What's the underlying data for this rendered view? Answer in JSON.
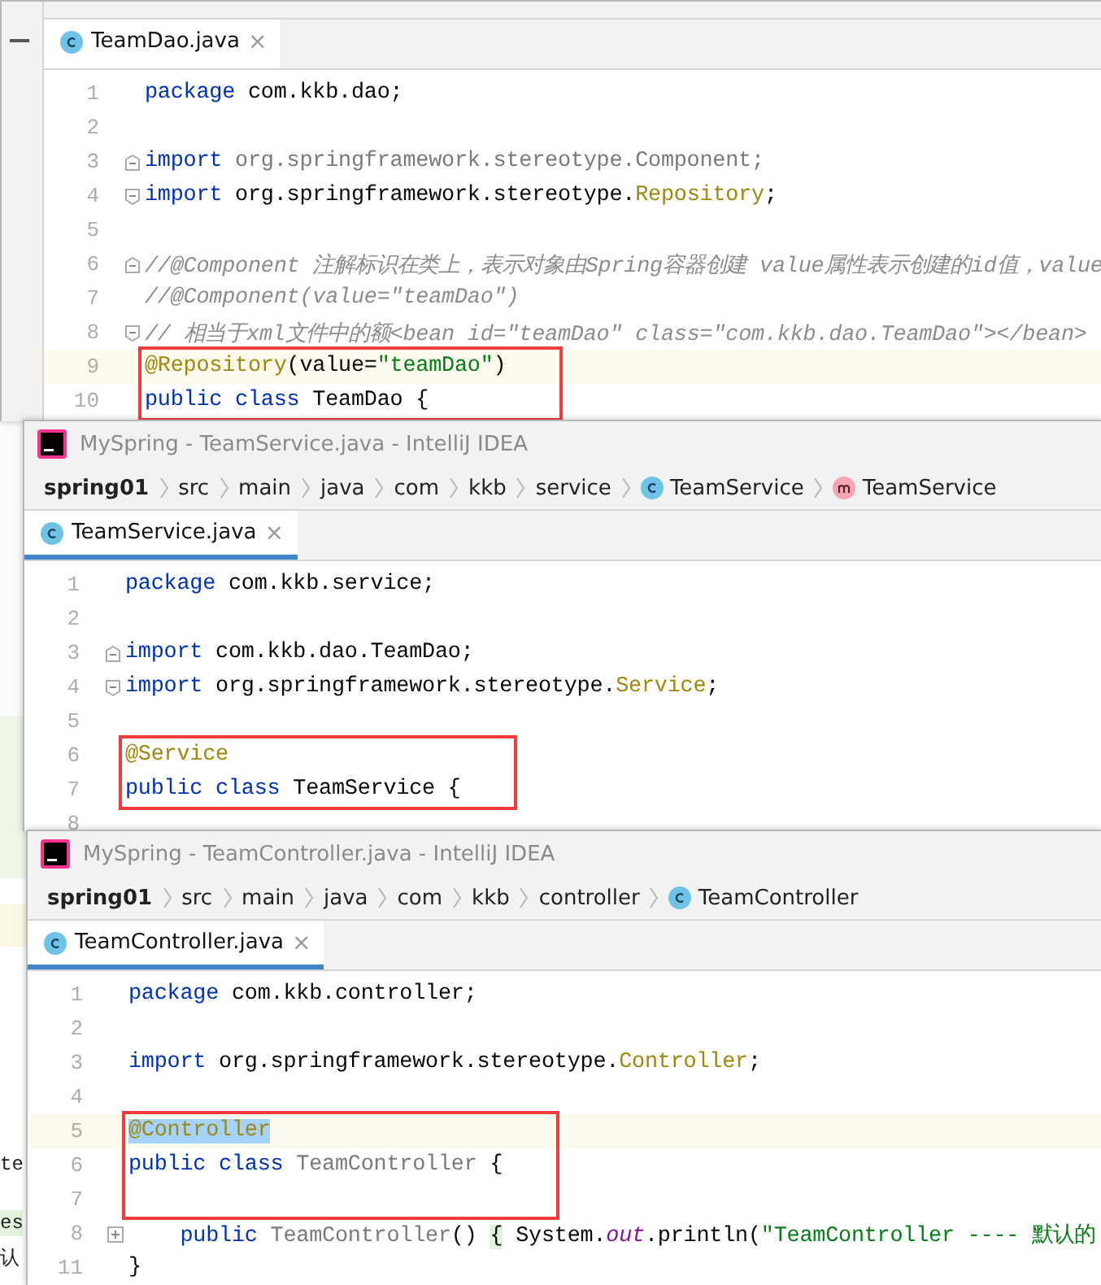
{
  "background_fragments": [
    {
      "text": "te",
      "kind": "plain"
    },
    {
      "text": "es",
      "kind": "string"
    },
    {
      "text": "认",
      "kind": "plain"
    }
  ],
  "windows": [
    {
      "kind": "editor-only",
      "tab": {
        "label": "TeamDao.java",
        "close": "×",
        "selected": false
      },
      "lines": [
        {
          "number": "1",
          "tokens": [
            {
              "kind": "kw",
              "text": "package"
            },
            {
              "kind": "plain",
              "text": " com.kkb.dao;"
            }
          ]
        },
        {
          "number": "2"
        },
        {
          "number": "3",
          "kind": "fold-start",
          "tokens": [
            {
              "kind": "kw",
              "text": "import"
            },
            {
              "kind": "unused",
              "text": " org.springframework.stereotype.Component;"
            }
          ]
        },
        {
          "number": "4",
          "kind": "fold-end",
          "tokens": [
            {
              "kind": "kw",
              "text": "import"
            },
            {
              "kind": "plain",
              "text": " org.springframework.stereotype."
            },
            {
              "kind": "ann",
              "text": "Repository"
            },
            {
              "kind": "plain",
              "text": ";"
            }
          ]
        },
        {
          "number": "5"
        },
        {
          "number": "6",
          "kind": "fold-start",
          "tokens": [
            {
              "kind": "comment",
              "text": "//@Component 注解标识在类上，表示对象由Spring容器创建 value属性表示创建的id值，value"
            }
          ]
        },
        {
          "number": "7",
          "tokens": [
            {
              "kind": "comment",
              "text": "//@Component(value=\"teamDao\")"
            }
          ]
        },
        {
          "number": "8",
          "kind": "fold-end",
          "tokens": [
            {
              "kind": "comment",
              "text": "// 相当于xml文件中的额<bean id=\"teamDao\" class=\"com.kkb.dao.TeamDao\"></bean>"
            }
          ]
        },
        {
          "number": "9",
          "current": true,
          "boxed": true,
          "tokens": [
            {
              "kind": "ann",
              "text": "@Repository"
            },
            {
              "kind": "plain",
              "text": "(value="
            },
            {
              "kind": "str",
              "text": "\"teamDao\""
            },
            {
              "kind": "plain",
              "text": ")"
            }
          ]
        },
        {
          "number": "10",
          "boxed": true,
          "tokens": [
            {
              "kind": "kw",
              "text": "public class"
            },
            {
              "kind": "plain",
              "text": " TeamDao {"
            }
          ]
        }
      ]
    },
    {
      "kind": "full",
      "title": "MySpring - TeamService.java - IntelliJ IDEA",
      "breadcrumbs": [
        {
          "label": "spring01",
          "kind": "plain"
        },
        {
          "label": "src",
          "kind": "plain"
        },
        {
          "label": "main",
          "kind": "plain"
        },
        {
          "label": "java",
          "kind": "plain"
        },
        {
          "label": "com",
          "kind": "plain"
        },
        {
          "label": "kkb",
          "kind": "plain"
        },
        {
          "label": "service",
          "kind": "plain"
        },
        {
          "label": "TeamService",
          "kind": "class"
        },
        {
          "label": "TeamService",
          "kind": "method"
        }
      ],
      "tab": {
        "label": "TeamService.java",
        "close": "×",
        "selected": true
      },
      "lines": [
        {
          "number": "1",
          "tokens": [
            {
              "kind": "kw",
              "text": "package"
            },
            {
              "kind": "plain",
              "text": " com.kkb.service;"
            }
          ]
        },
        {
          "number": "2"
        },
        {
          "number": "3",
          "kind": "fold-start",
          "tokens": [
            {
              "kind": "kw",
              "text": "import"
            },
            {
              "kind": "plain",
              "text": " com.kkb.dao.TeamDao;"
            }
          ]
        },
        {
          "number": "4",
          "kind": "fold-end",
          "tokens": [
            {
              "kind": "kw",
              "text": "import"
            },
            {
              "kind": "plain",
              "text": " org.springframework.stereotype."
            },
            {
              "kind": "ann",
              "text": "Service"
            },
            {
              "kind": "plain",
              "text": ";"
            }
          ]
        },
        {
          "number": "5"
        },
        {
          "number": "6",
          "boxed": true,
          "tokens": [
            {
              "kind": "ann",
              "text": "@Service"
            }
          ]
        },
        {
          "number": "7",
          "boxed": true,
          "tokens": [
            {
              "kind": "kw",
              "text": "public class"
            },
            {
              "kind": "plain",
              "text": " TeamService {"
            }
          ]
        },
        {
          "number": "8"
        }
      ]
    },
    {
      "kind": "full",
      "title": "MySpring - TeamController.java - IntelliJ IDEA",
      "breadcrumbs": [
        {
          "label": "spring01",
          "kind": "plain"
        },
        {
          "label": "src",
          "kind": "plain"
        },
        {
          "label": "main",
          "kind": "plain"
        },
        {
          "label": "java",
          "kind": "plain"
        },
        {
          "label": "com",
          "kind": "plain"
        },
        {
          "label": "kkb",
          "kind": "plain"
        },
        {
          "label": "controller",
          "kind": "plain"
        },
        {
          "label": "TeamController",
          "kind": "class"
        }
      ],
      "tab": {
        "label": "TeamController.java",
        "close": "×",
        "selected": true
      },
      "lines": [
        {
          "number": "1",
          "tokens": [
            {
              "kind": "kw",
              "text": "package"
            },
            {
              "kind": "plain",
              "text": " com.kkb.controller;"
            }
          ]
        },
        {
          "number": "2"
        },
        {
          "number": "3",
          "tokens": [
            {
              "kind": "kw",
              "text": "import"
            },
            {
              "kind": "plain",
              "text": " org.springframework.stereotype."
            },
            {
              "kind": "ann",
              "text": "Controller"
            },
            {
              "kind": "plain",
              "text": ";"
            }
          ]
        },
        {
          "number": "4"
        },
        {
          "number": "5",
          "current": true,
          "boxed": true,
          "tokens": [
            {
              "kind": "ann",
              "text": "@Controller",
              "selected": true
            }
          ]
        },
        {
          "number": "6",
          "boxed": true,
          "tokens": [
            {
              "kind": "kw",
              "text": "public class"
            },
            {
              "kind": "unused",
              "text": " TeamController"
            },
            {
              "kind": "plain",
              "text": " {"
            }
          ]
        },
        {
          "number": "7",
          "boxed": true
        },
        {
          "number": "8",
          "kind": "folded",
          "tokens": [
            {
              "kind": "kw",
              "text": "    public"
            },
            {
              "kind": "unused",
              "text": " TeamController"
            },
            {
              "kind": "plain",
              "text": "() "
            },
            {
              "kind": "brace",
              "text": "{"
            },
            {
              "kind": "plain",
              "text": " System."
            },
            {
              "kind": "static",
              "text": "out"
            },
            {
              "kind": "plain",
              "text": ".println("
            },
            {
              "kind": "str",
              "text": "\"TeamController ---- 默认的"
            }
          ]
        },
        {
          "number": "11",
          "tokens": [
            {
              "kind": "plain",
              "text": "}"
            }
          ]
        }
      ]
    }
  ]
}
